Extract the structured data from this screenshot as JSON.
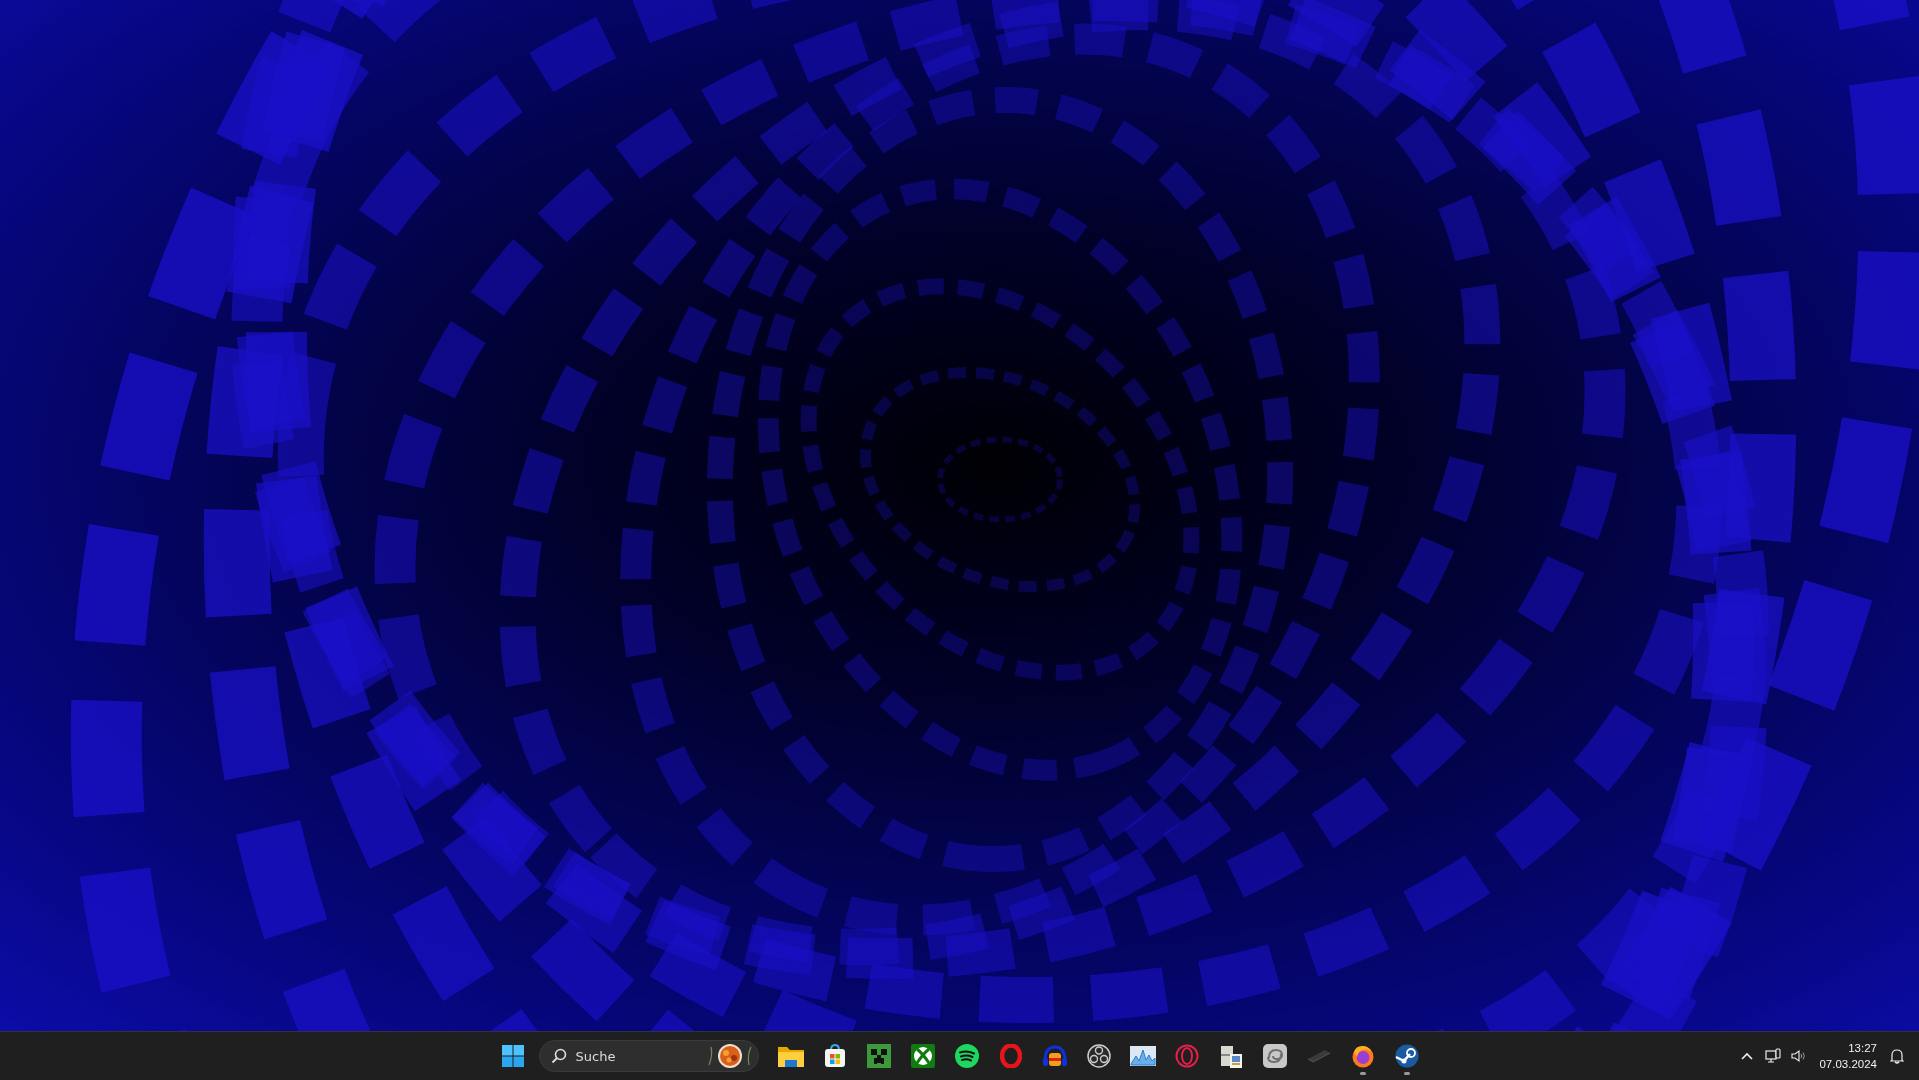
{
  "taskbar": {
    "search": {
      "placeholder": "Suche"
    },
    "apps": [
      {
        "kind": "folder",
        "running": false
      },
      {
        "kind": "store",
        "running": false
      },
      {
        "kind": "creeper",
        "running": false
      },
      {
        "kind": "xbox",
        "running": false
      },
      {
        "kind": "spotify",
        "running": false
      },
      {
        "kind": "opera",
        "running": false
      },
      {
        "kind": "headphones",
        "running": false
      },
      {
        "kind": "aperture",
        "running": false
      },
      {
        "kind": "monitor",
        "running": false
      },
      {
        "kind": "ring",
        "running": false
      },
      {
        "kind": "scanner",
        "running": false
      },
      {
        "kind": "swirl",
        "running": false
      },
      {
        "kind": "pen",
        "running": false
      },
      {
        "kind": "firefox",
        "running": true
      },
      {
        "kind": "steam",
        "running": true
      }
    ]
  },
  "tray": {
    "time": "13:27",
    "date": "07.03.2024"
  }
}
